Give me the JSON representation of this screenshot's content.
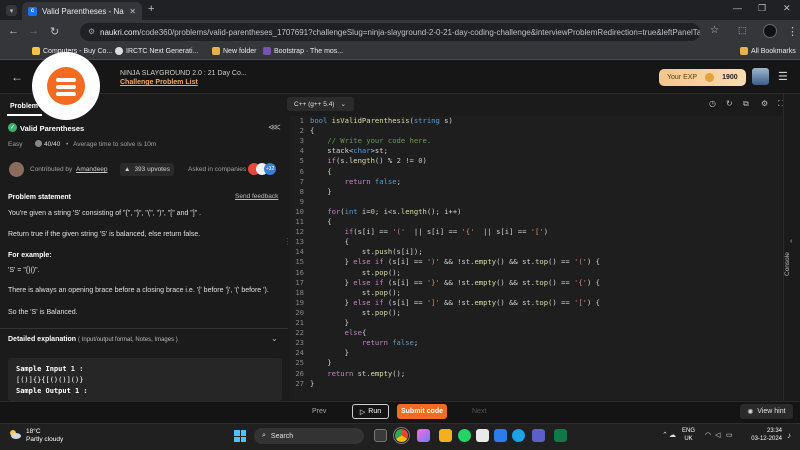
{
  "browser": {
    "tab_title": "Valid Parentheses - Naukri Code",
    "url_host": "naukri.com",
    "url_rest": "/code360/problems/valid-parentheses_1707691?challengeSlug=ninja-slayground-2-0-21-day-coding-challenge&interviewProblemRedirection=true&leftPanelTabValue=PRO...",
    "bookmarks": [
      "Computers - Buy Co...",
      "IRCTC Next Generati...",
      "New folder",
      "Bootstrap · The mos..."
    ],
    "all_bookmarks": "All Bookmarks"
  },
  "header": {
    "challenge_title": "NINJA SLAYGROUND 2.0 : 21 Day Co...",
    "challenge_link": "Challenge Problem List",
    "exp_label": "Your EXP",
    "exp_value": "1900"
  },
  "problem": {
    "tab_label": "Problem",
    "title": "Valid Parentheses",
    "difficulty": "Easy",
    "score": "40/40",
    "avg_time": "Average time to solve is 10m",
    "contributed_label": "Contributed by",
    "contributor": "Amandeep",
    "upvotes": "393 upvotes",
    "asked_in": "Asked in companies",
    "more_companies": "+32",
    "statement_heading": "Problem statement",
    "feedback": "Send feedback",
    "para1": "You're given a string 'S' consisting of \"{\", \"}\", \"(\", \")\", \"[\" and \"]\" .",
    "para2": "Return true if the given string 'S' is balanced, else return false.",
    "example_heading": "For example:",
    "example_value": "'S' = \"{}()\".",
    "para3": "There is always an opening brace before a closing brace i.e. '{' before '}', '(' before ').",
    "para4": "So the 'S' is Balanced.",
    "detail_heading": "Detailed explanation",
    "detail_sub": "( Input/output format, Notes, Images )",
    "sample_in_label": "Sample Input 1 :",
    "sample_in_value": "[()]{}{[()()]()}",
    "sample_out_label": "Sample Output 1 :"
  },
  "editor": {
    "language": "C++ (g++ 5.4)",
    "line_numbers": [
      "1",
      "2",
      "3",
      "4",
      "5",
      "6",
      "7",
      "8",
      "9",
      "10",
      "11",
      "12",
      "13",
      "14",
      "15",
      "16",
      "17",
      "18",
      "19",
      "20",
      "21",
      "22",
      "23",
      "24",
      "25",
      "26",
      "27"
    ]
  },
  "console_label": "Console",
  "bottom": {
    "prev": "Prev",
    "run": "Run",
    "submit": "Submit code",
    "next": "Next",
    "hint": "View hint"
  },
  "taskbar": {
    "temp": "18°C",
    "weather": "Partly cloudy",
    "search": "Search",
    "lang1": "ENG",
    "lang2": "UK",
    "time": "23:34",
    "date": "03-12-2024"
  },
  "colors": {
    "accent": "#f26b21",
    "success": "#3cb371",
    "editor_bg": "#1e1e1e"
  }
}
